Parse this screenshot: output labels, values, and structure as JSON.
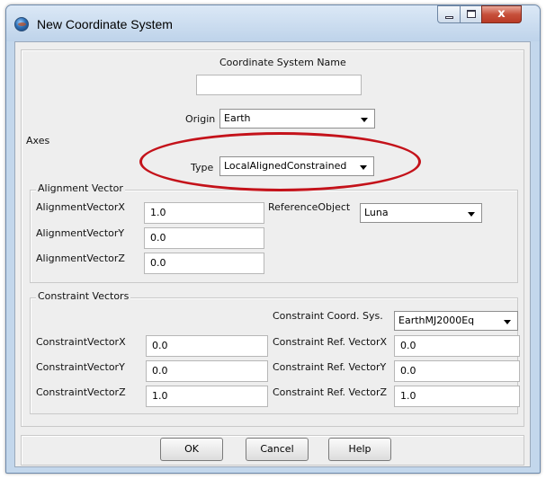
{
  "window": {
    "title": "New Coordinate System",
    "controls": {
      "minimize": "minimize",
      "maximize": "maximize",
      "close": "x"
    }
  },
  "name_section": {
    "label": "Coordinate System Name",
    "value": ""
  },
  "origin": {
    "label": "Origin",
    "value": "Earth"
  },
  "axes": {
    "title": "Axes",
    "type": {
      "label": "Type",
      "value": "LocalAlignedConstrained"
    },
    "alignment": {
      "title": "Alignment Vector",
      "x": {
        "label": "AlignmentVectorX",
        "value": "1.0"
      },
      "y": {
        "label": "AlignmentVectorY",
        "value": "0.0"
      },
      "z": {
        "label": "AlignmentVectorZ",
        "value": "0.0"
      },
      "reference_object": {
        "label": "ReferenceObject",
        "value": "Luna"
      }
    },
    "constraint": {
      "title": "Constraint Vectors",
      "coord_sys": {
        "label": "Constraint Coord. Sys.",
        "value": "EarthMJ2000Eq"
      },
      "x": {
        "label": "ConstraintVectorX",
        "value": "0.0"
      },
      "y": {
        "label": "ConstraintVectorY",
        "value": "0.0"
      },
      "z": {
        "label": "ConstraintVectorZ",
        "value": "1.0"
      },
      "ref_x": {
        "label": "Constraint Ref. VectorX",
        "value": "0.0"
      },
      "ref_y": {
        "label": "Constraint Ref. VectorY",
        "value": "0.0"
      },
      "ref_z": {
        "label": "Constraint Ref. VectorZ",
        "value": "1.0"
      }
    }
  },
  "buttons": {
    "ok": "OK",
    "cancel": "Cancel",
    "help": "Help"
  },
  "colors": {
    "highlight_ellipse": "#c4121a",
    "dialog_background": "#eeeeee"
  }
}
